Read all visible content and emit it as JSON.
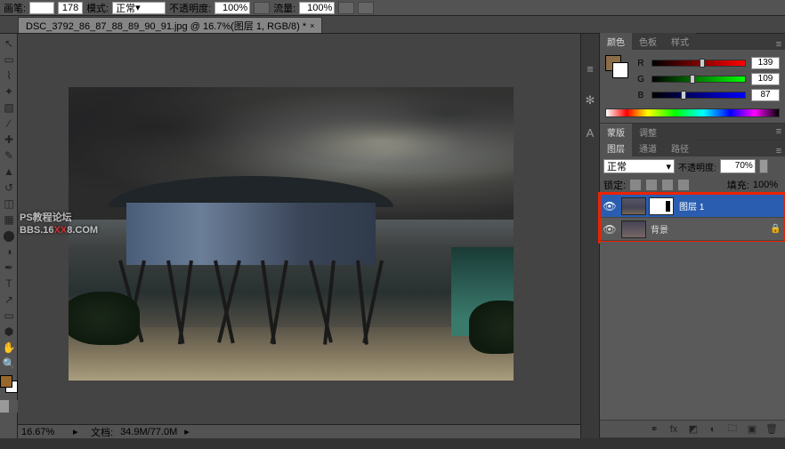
{
  "optbar": {
    "label_brush": "画笔:",
    "brush_size": "178",
    "label_mode": "模式:",
    "mode_value": "正常",
    "label_opacity": "不透明度:",
    "opacity_value": "100%",
    "label_flow": "流量:",
    "flow_value": "100%"
  },
  "tab": {
    "title": "DSC_3792_86_87_88_89_90_91.jpg @ 16.7%(图层 1, RGB/8) *",
    "close": "×"
  },
  "tools": [
    {
      "name": "move-tool",
      "glyph": "↖"
    },
    {
      "name": "marquee-tool",
      "glyph": "▭"
    },
    {
      "name": "lasso-tool",
      "glyph": "⌇"
    },
    {
      "name": "wand-tool",
      "glyph": "✦"
    },
    {
      "name": "crop-tool",
      "glyph": "▧"
    },
    {
      "name": "eyedrop-tool",
      "glyph": "⁄"
    },
    {
      "name": "heal-tool",
      "glyph": "✚"
    },
    {
      "name": "brush-tool",
      "glyph": "✎"
    },
    {
      "name": "stamp-tool",
      "glyph": "▲"
    },
    {
      "name": "history-brush-tool",
      "glyph": "↺"
    },
    {
      "name": "eraser-tool",
      "glyph": "◫"
    },
    {
      "name": "gradient-tool",
      "glyph": "▦"
    },
    {
      "name": "blur-tool",
      "glyph": "⬤"
    },
    {
      "name": "dodge-tool",
      "glyph": "◑"
    },
    {
      "name": "pen-tool",
      "glyph": "✒"
    },
    {
      "name": "type-tool",
      "glyph": "T"
    },
    {
      "name": "path-tool",
      "glyph": "↗"
    },
    {
      "name": "shape-tool",
      "glyph": "▭"
    },
    {
      "name": "3d-tool",
      "glyph": "⬢"
    },
    {
      "name": "hand-tool",
      "glyph": "✋"
    },
    {
      "name": "zoom-tool",
      "glyph": "🔍"
    }
  ],
  "watermark": {
    "line1": "PS教程论坛",
    "line2a": "BBS.16",
    "line2b": "XX",
    "line2c": "8.COM"
  },
  "statusbar": {
    "zoom": "16.67%",
    "doc_label": "文档:",
    "doc_value": "34.9M/77.0M"
  },
  "midicons": [
    {
      "name": "history-icon",
      "glyph": "≡"
    },
    {
      "name": "gear-icon",
      "glyph": "✻"
    },
    {
      "name": "char-icon",
      "glyph": "A"
    }
  ],
  "color_panel": {
    "tabs": [
      "颜色",
      "色板",
      "样式"
    ],
    "channels": [
      {
        "lbl": "R",
        "val": "139",
        "pct": 54
      },
      {
        "lbl": "G",
        "val": "109",
        "pct": 43
      },
      {
        "lbl": "B",
        "val": "87",
        "pct": 34
      }
    ]
  },
  "adjust_panel": {
    "tabs": [
      "蒙版",
      "调整"
    ]
  },
  "layers_panel": {
    "tabs": [
      "图层",
      "通道",
      "路径"
    ],
    "blend_label": "正常",
    "opacity_label": "不透明度:",
    "opacity_value": "70%",
    "lock_label": "锁定:",
    "fill_label": "填充:",
    "fill_value": "100%",
    "layers": [
      {
        "name": "图层 1",
        "selected": true,
        "has_mask": true,
        "locked": false
      },
      {
        "name": "背景",
        "selected": false,
        "has_mask": false,
        "locked": true
      }
    ]
  },
  "layer_footer_icons": [
    {
      "name": "link-icon",
      "glyph": "⚭"
    },
    {
      "name": "fx-icon",
      "glyph": "fx"
    },
    {
      "name": "mask-icon",
      "glyph": "◩"
    },
    {
      "name": "adj-icon",
      "glyph": "◐"
    },
    {
      "name": "group-icon",
      "glyph": "🗀"
    },
    {
      "name": "new-layer-icon",
      "glyph": "▣"
    },
    {
      "name": "trash-icon",
      "glyph": "🗑"
    }
  ]
}
